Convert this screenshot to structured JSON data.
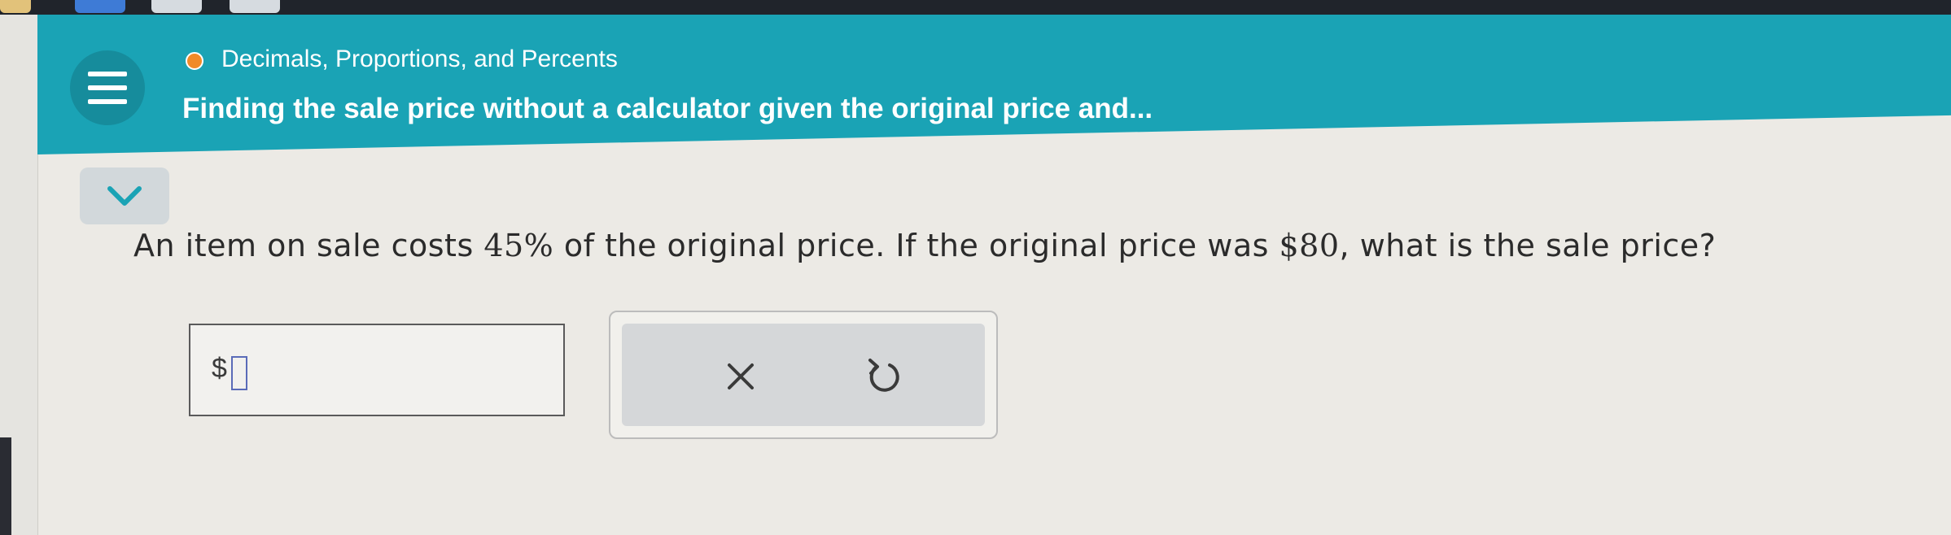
{
  "header": {
    "topic": "Decimals, Proportions, and Percents",
    "title": "Finding the sale price without a calculator given the original price and...",
    "menu_icon": "hamburger-icon",
    "status_icon": "progress-dot-icon",
    "accent_color": "#1aa3b5",
    "status_color": "#f08a28"
  },
  "question": {
    "prefix": "An item on sale costs ",
    "percent": "45%",
    "middle": " of the original price. If the original price was ",
    "price": "$80",
    "suffix": ", what is the sale price?"
  },
  "answer": {
    "currency": "$",
    "value": ""
  },
  "actions": {
    "clear_icon": "close-icon",
    "undo_icon": "undo-icon",
    "collapse_icon": "chevron-down-icon"
  }
}
